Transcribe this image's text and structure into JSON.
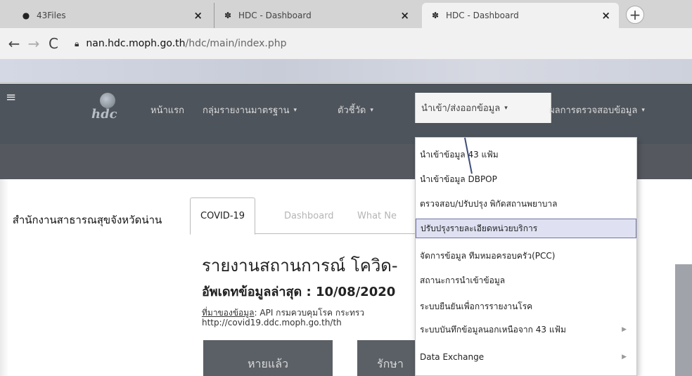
{
  "browser": {
    "tabs": [
      {
        "title": "43Files",
        "icon": "github-icon",
        "active": false
      },
      {
        "title": "HDC - Dashboard",
        "icon": "hdc-favicon",
        "active": false
      },
      {
        "title": "HDC - Dashboard",
        "icon": "hdc-favicon",
        "active": true
      }
    ],
    "close_glyph": "×",
    "new_tab_glyph": "+",
    "back_glyph": "←",
    "forward_glyph": "→",
    "reload_glyph": "C",
    "url_host": "nan.hdc.moph.go.th",
    "url_path": "/hdc/main/index.php"
  },
  "navbar": {
    "hamburger_glyph": "≡",
    "logo_text": "hdc",
    "items": [
      {
        "label": "หน้าแรก",
        "has_caret": false
      },
      {
        "label": "กลุ่มรายงานมาตรฐาน",
        "has_caret": true
      },
      {
        "label": "ตัวชี้วัด",
        "has_caret": true
      },
      {
        "label": "นำเข้า/ส่งออกข้อมูล",
        "has_caret": true,
        "open": true
      },
      {
        "label": "ผลการตรวจสอบข้อมูล",
        "has_caret": true
      }
    ],
    "caret_glyph": "▾"
  },
  "dropdown": {
    "items": [
      {
        "label": "นำเข้าข้อมูล 43 แฟ้ม",
        "submenu": false,
        "highlighted": false
      },
      {
        "label": "นำเข้าข้อมูล DBPOP",
        "submenu": false,
        "highlighted": false
      },
      {
        "label": "ตรวจสอบ/ปรับปรุง พิกัดสถานพยาบาล",
        "submenu": false,
        "highlighted": false
      },
      {
        "label": "ปรับปรุงรายละเอียดหน่วยบริการ",
        "submenu": false,
        "highlighted": true
      },
      {
        "label": "จัดการข้อมูล ทีมหมอครอบครัว(PCC)",
        "submenu": false,
        "highlighted": false
      },
      {
        "label": "สถานะการนำเข้าข้อมูล",
        "submenu": false,
        "highlighted": false
      },
      {
        "label": "ระบบยืนยันเพื่อการรายงานโรค",
        "submenu": false,
        "highlighted": false
      },
      {
        "label": "ระบบบันทึกข้อมูลนอกเหนือจาก 43 แฟ้ม",
        "submenu": true,
        "highlighted": false
      },
      {
        "label": "Data Exchange",
        "submenu": true,
        "highlighted": false
      }
    ],
    "submenu_glyph": "▶"
  },
  "sidebar": {
    "org_name": "สำนักงานสาธารณสุขจังหวัดน่าน"
  },
  "content": {
    "tabs": [
      {
        "label": "COVID-19",
        "active": true
      },
      {
        "label": "Dashboard",
        "active": false
      },
      {
        "label": "What Ne",
        "active": false
      }
    ],
    "report_title": "รายงานสถานการณ์ โควิด-",
    "updated": "อัพเดทข้อมูลล่าสุด : 10/08/2020",
    "source_label": "ที่มาของข้อมูล",
    "source_text": ": API กรมควบคุมโรค กระทรว",
    "source_url": "http://covid19.ddc.moph.go.th/th",
    "cards": [
      "หายแล้ว",
      "รักษา"
    ]
  },
  "colors": {
    "navbar": "#4e545c",
    "active_menu": "#f4f4f4",
    "highlight": "#dfe1f2",
    "card": "#5b6066"
  }
}
